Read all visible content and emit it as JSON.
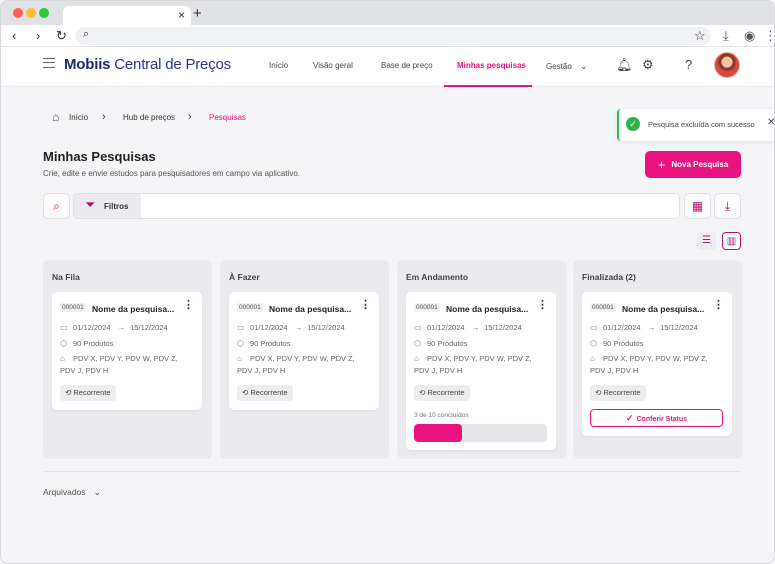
{
  "browser": {
    "colors": {
      "close": "#ff5f57",
      "min": "#febc2e",
      "max": "#28c840"
    },
    "tab_close": "×",
    "new_tab": "+"
  },
  "app": {
    "brand_bold": "Mobiis",
    "brand_rest": " Central de Preços",
    "accent": "#e8137f",
    "nav": [
      "Início",
      "Visão geral",
      "Base de preço",
      "Minhas pesquisas",
      "Gestão"
    ],
    "active_nav": "Minhas pesquisas"
  },
  "breadcrumb": [
    "Início",
    "Hub de preços",
    "Pesquisas"
  ],
  "toast": {
    "text": "Pesquisa excluída com sucesso",
    "color": "#2fb24c"
  },
  "page": {
    "title": "Minhas Pesquisas",
    "subtitle": "Crie, edite e envie estudos para pesquisadores em campo via aplicativo.",
    "new_button": "Nova Pesquisa",
    "filter_label": "Filtros",
    "archived_label": "Arquivados"
  },
  "columns": [
    {
      "title": "Na Fila",
      "card": {
        "code": "000001",
        "name": "Nome da pesquisa...",
        "start": "01/12/2024",
        "end": "15/12/2024",
        "products": "90 Produtos",
        "stores": "PDV X, PDV Y, PDV W, PDV Z, PDV J, PDV H",
        "tag": "Recorrente"
      }
    },
    {
      "title": "À Fazer",
      "card": {
        "code": "000001",
        "name": "Nome da pesquisa...",
        "start": "01/12/2024",
        "end": "15/12/2024",
        "products": "90 Produtos",
        "stores": "PDV X, PDV Y, PDV W, PDV Z, PDV J, PDV H",
        "tag": "Recorrente"
      }
    },
    {
      "title": "Em Andamento",
      "card": {
        "code": "000001",
        "name": "Nome da pesquisa...",
        "start": "01/12/2024",
        "end": "15/12/2024",
        "products": "90 Produtos",
        "stores": "PDV X, PDV Y, PDV W, PDV Z, PDV J, PDV H",
        "tag": "Recorrente",
        "progress_label": "3 de 10 concluídos",
        "progress": 0.36
      }
    },
    {
      "title": "Finalizada (2)",
      "card": {
        "code": "000001",
        "name": "Nome da pesquisa...",
        "start": "01/12/2024",
        "end": "15/12/2024",
        "products": "90 Produtos",
        "stores": "PDV X, PDV Y, PDV W, PDV Z, PDV J, PDV H",
        "tag": "Recorrente",
        "action": "Conferir Status"
      }
    }
  ]
}
